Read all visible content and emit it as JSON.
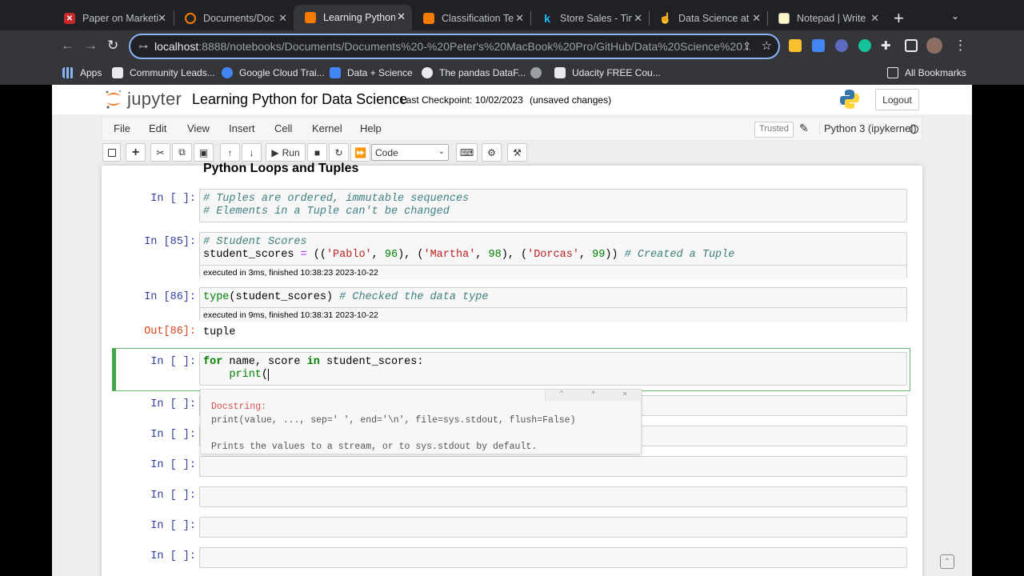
{
  "browser": {
    "tabs": [
      {
        "title": "Paper on Marketi",
        "fav_color": "#c62828",
        "fav_glyph": "✕"
      },
      {
        "title": "Documents/Doc",
        "fav_color": "#f57c00",
        "fav_glyph": "◯"
      },
      {
        "title": "Learning Python",
        "fav_color": "#f57c00",
        "fav_glyph": "▮"
      },
      {
        "title": "Classification Te",
        "fav_color": "#f57c00",
        "fav_glyph": "▮"
      },
      {
        "title": "Store Sales - Tim",
        "fav_color": "#20beff",
        "fav_glyph": "k"
      },
      {
        "title": "Data Science at",
        "fav_color": "#f4b400",
        "fav_glyph": "☝"
      },
      {
        "title": "Notepad | Write",
        "fav_color": "#fff8c4",
        "fav_glyph": ""
      }
    ],
    "url_host": "localhost",
    "url_rest": ":8888/notebooks/Documents/Documents%20-%20Peter's%20MacBook%20Pro/GitHub/Data%20Science%20...",
    "bookmarks": [
      {
        "label": "Apps",
        "color": "#8ab4f8"
      },
      {
        "label": "Community Leads...",
        "color": "#e8eaed"
      },
      {
        "label": "Google Cloud Trai...",
        "color": "#4285f4"
      },
      {
        "label": "Data + Science",
        "color": "#4285f4"
      },
      {
        "label": "The pandas DataF...",
        "color": "#e8eaed"
      },
      {
        "label": "",
        "color": "#9aa0a6"
      },
      {
        "label": "Udacity FREE Cou...",
        "color": "#e8eaed"
      }
    ],
    "all_bookmarks": "All Bookmarks"
  },
  "jupyter": {
    "logo_text": "jupyter",
    "notebook_title": "Learning Python for Data Science",
    "checkpoint": "Last Checkpoint: 10/02/2023",
    "unsaved": "(unsaved changes)",
    "logout": "Logout",
    "menu": [
      "File",
      "Edit",
      "View",
      "Insert",
      "Cell",
      "Kernel",
      "Help"
    ],
    "trusted": "Trusted",
    "kernel": "Python 3 (ipykernel)",
    "run_label": "Run",
    "cell_type": "Code"
  },
  "notebook": {
    "heading": "Python Loops and Tuples",
    "cells": {
      "c1": {
        "prompt": "In [ ]:"
      },
      "c2": {
        "prompt": "In [85]:",
        "exec": "executed in 3ms, finished 10:38:23 2023-10-22"
      },
      "c3": {
        "prompt": "In [86]:",
        "exec": "executed in 9ms, finished 10:38:31 2023-10-22",
        "out_prompt": "Out[86]:",
        "output": "tuple"
      },
      "c4": {
        "prompt": "In [ ]:"
      },
      "empty_prompt": "In [ ]:"
    },
    "tooltip": {
      "title": "Docstring:",
      "sig": "print(value, ..., sep=' ', end='\\n', file=sys.stdout, flush=False)",
      "desc": "Prints the values to a stream, or to sys.stdout by default."
    }
  }
}
